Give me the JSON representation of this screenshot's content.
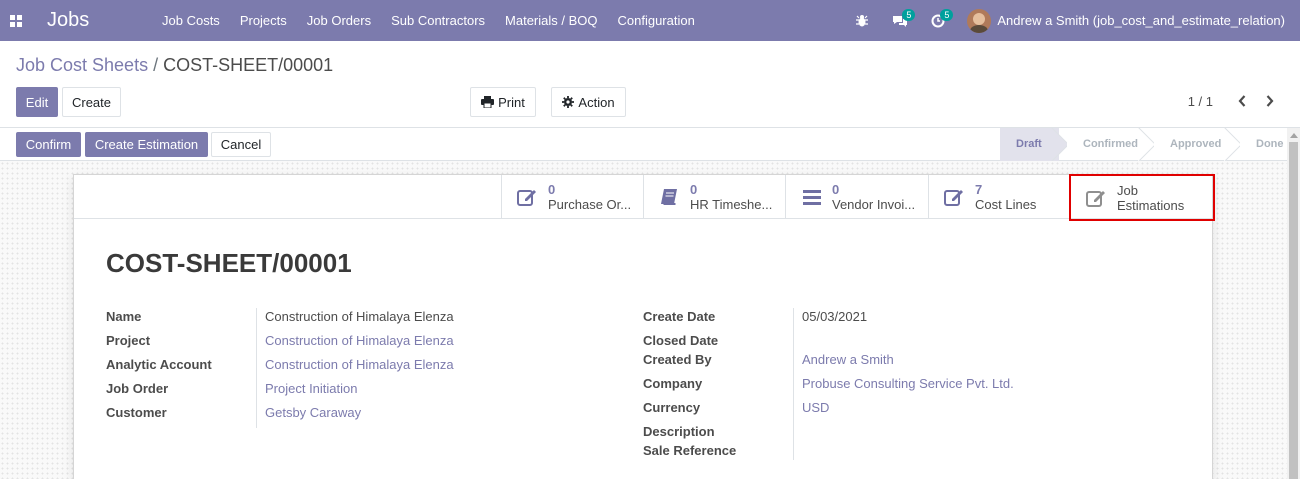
{
  "navbar": {
    "app_name": "Jobs",
    "menu": [
      "Job Costs",
      "Projects",
      "Job Orders",
      "Sub Contractors",
      "Materials / BOQ",
      "Configuration"
    ],
    "messages_count": "5",
    "activities_count": "5",
    "user": "Andrew a Smith (job_cost_and_estimate_relation)"
  },
  "breadcrumb": {
    "parent": "Job Cost Sheets",
    "separator": "/",
    "current": "COST-SHEET/00001"
  },
  "buttons": {
    "edit": "Edit",
    "create": "Create",
    "print": "Print",
    "action": "Action"
  },
  "pager": {
    "value": "1 / 1"
  },
  "statusbar": {
    "confirm": "Confirm",
    "create_estimation": "Create Estimation",
    "cancel": "Cancel",
    "stages": [
      "Draft",
      "Confirmed",
      "Approved",
      "Done"
    ],
    "current_stage": "Draft"
  },
  "smart_buttons": [
    {
      "value": "0",
      "label": "Purchase Or...",
      "icon": "edit-icon"
    },
    {
      "value": "0",
      "label": "HR Timeshe...",
      "icon": "book-icon"
    },
    {
      "value": "0",
      "label": "Vendor Invoi...",
      "icon": "list-icon"
    },
    {
      "value": "7",
      "label": "Cost Lines",
      "icon": "edit-icon"
    },
    {
      "value": "Job",
      "label": "Estimations",
      "icon": "edit-icon"
    }
  ],
  "record": {
    "title": "COST-SHEET/00001",
    "left_fields": [
      {
        "label": "Name",
        "value": "Construction of Himalaya Elenza"
      },
      {
        "label": "Project",
        "value": "Construction of Himalaya Elenza"
      },
      {
        "label": "Analytic Account",
        "value": "Construction of Himalaya Elenza"
      },
      {
        "label": "Job Order",
        "value": "Project Initiation"
      },
      {
        "label": "Customer",
        "value": "Getsby Caraway"
      }
    ],
    "right_fields": [
      {
        "label": "Create Date",
        "value": "05/03/2021"
      },
      {
        "label": "Closed Date",
        "value": ""
      },
      {
        "label": "Created By",
        "value": "Andrew a Smith"
      },
      {
        "label": "Company",
        "value": "Probuse Consulting Service Pvt. Ltd."
      },
      {
        "label": "Currency",
        "value": "USD"
      },
      {
        "label": "Description",
        "value": ""
      },
      {
        "label": "Sale Reference",
        "value": ""
      }
    ]
  },
  "colors": {
    "brand": "#7c7bad",
    "highlight": "#e00000"
  }
}
